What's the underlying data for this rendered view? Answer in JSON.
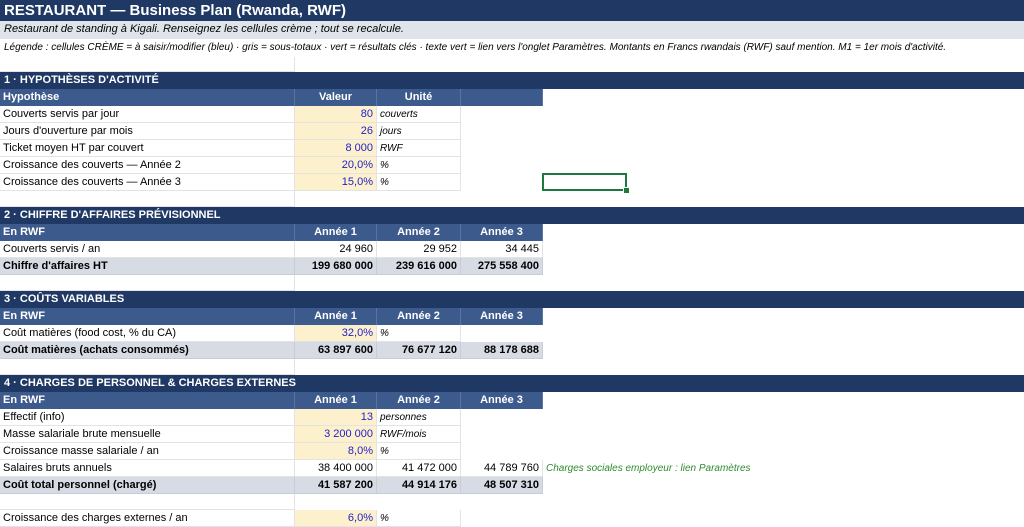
{
  "title": "RESTAURANT — Business Plan (Rwanda, RWF)",
  "subtitle": "Restaurant de standing à Kigali. Renseignez les cellules crème ; tout se recalcule.",
  "legend": "Légende : cellules CRÈME = à saisir/modifier (bleu) · gris = sous-totaux · vert = résultats clés · texte vert = lien vers l'onglet Paramètres. Montants en Francs rwandais (RWF) sauf mention. M1 = 1er mois d'activité.",
  "colors": {
    "band": "#1f3864",
    "header": "#3d5a8c",
    "input_fill": "#fdf0cc",
    "input_text": "#1f1fcc",
    "subtotal": "#d6dbe4",
    "link_text": "#2e8b2e",
    "selection": "#1e7a3c"
  },
  "s1": {
    "band": "1 · HYPOTHÈSES D'ACTIVITÉ",
    "h_label": "Hypothèse",
    "h_value": "Valeur",
    "h_unit": "Unité",
    "rows": [
      {
        "label": "Couverts servis par jour",
        "value": "80",
        "unit": "couverts"
      },
      {
        "label": "Jours d'ouverture par mois",
        "value": "26",
        "unit": "jours"
      },
      {
        "label": "Ticket moyen HT par couvert",
        "value": "8 000",
        "unit": "RWF"
      },
      {
        "label": "Croissance des couverts — Année 2",
        "value": "20,0%",
        "unit": "%"
      },
      {
        "label": "Croissance des couverts — Année 3",
        "value": "15,0%",
        "unit": "%"
      }
    ]
  },
  "s2": {
    "band": "2 · CHIFFRE D'AFFAIRES PRÉVISIONNEL",
    "h_label": "En RWF",
    "y1": "Année 1",
    "y2": "Année 2",
    "y3": "Année 3",
    "row1": {
      "label": "Couverts servis / an",
      "v1": "24 960",
      "v2": "29 952",
      "v3": "34 445"
    },
    "total": {
      "label": "Chiffre d'affaires HT",
      "v1": "199 680 000",
      "v2": "239 616 000",
      "v3": "275 558 400"
    }
  },
  "s3": {
    "band": "3 · COÛTS VARIABLES",
    "h_label": "En RWF",
    "y1": "Année 1",
    "y2": "Année 2",
    "y3": "Année 3",
    "row1": {
      "label": "Coût matières (food cost, % du CA)",
      "value": "32,0%",
      "unit": "%"
    },
    "total": {
      "label": "Coût matières (achats consommés)",
      "v1": "63 897 600",
      "v2": "76 677 120",
      "v3": "88 178 688"
    }
  },
  "s4": {
    "band": "4 · CHARGES DE PERSONNEL & CHARGES EXTERNES",
    "h_label": "En RWF",
    "y1": "Année 1",
    "y2": "Année 2",
    "y3": "Année 3",
    "effectif": {
      "label": "Effectif (info)",
      "value": "13",
      "unit": "personnes"
    },
    "masse": {
      "label": "Masse salariale brute mensuelle",
      "value": "3 200 000",
      "unit": "RWF/mois"
    },
    "croissance": {
      "label": "Croissance masse salariale / an",
      "value": "8,0%",
      "unit": "%"
    },
    "salaires": {
      "label": "Salaires bruts annuels",
      "v1": "38 400 000",
      "v2": "41 472 000",
      "v3": "44 789 760",
      "note": "Charges sociales employeur : lien Paramètres"
    },
    "total": {
      "label": "Coût total personnel (chargé)",
      "v1": "41 587 200",
      "v2": "44 914 176",
      "v3": "48 507 310"
    },
    "externes": {
      "label": "Croissance des charges externes / an",
      "value": "6,0%",
      "unit": "%"
    }
  }
}
